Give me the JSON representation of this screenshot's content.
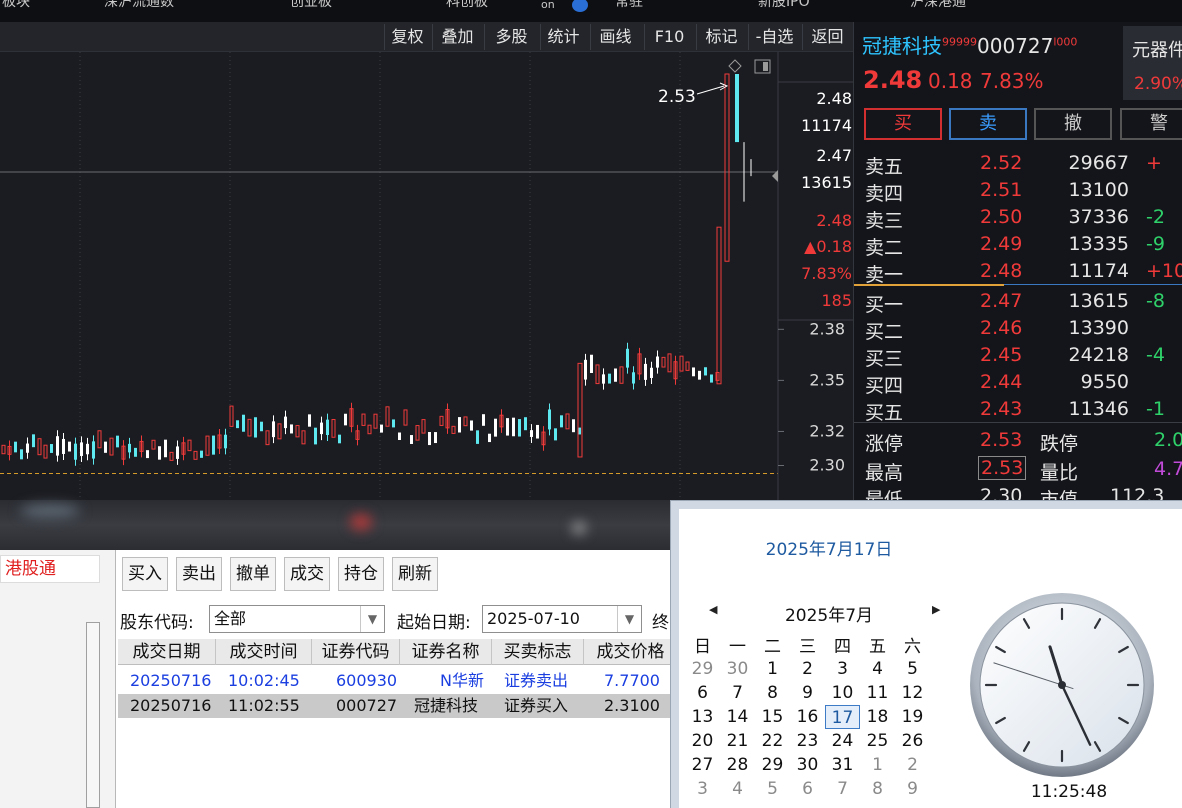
{
  "top_strip": {
    "items": [
      "板块",
      "深沪流通数",
      "创业板",
      "科创板",
      "on",
      "常驻",
      "新股IPO",
      "沪深港通"
    ]
  },
  "chart_toolbar": {
    "buttons": [
      "复权",
      "叠加",
      "多股",
      "统计",
      "画线",
      "F10",
      "标记",
      "-自选",
      "返回"
    ]
  },
  "chart": {
    "annotation_high": "2.53",
    "price_axis": {
      "ask_price": "2.48",
      "ask_vol": "11174",
      "bid_price": "2.47",
      "bid_vol": "13615",
      "last": "2.48",
      "change": "▲0.18",
      "pct": "7.83%",
      "vol": "185"
    },
    "y_ticks": [
      "2.38",
      "2.35",
      "2.32",
      "2.30"
    ]
  },
  "chart_data": {
    "type": "bar",
    "description_hint": "",
    "y_ticks": [
      2.38,
      2.35,
      2.32,
      2.3
    ],
    "ylim": [
      2.29,
      2.54
    ],
    "high": 2.53,
    "last": 2.48,
    "reference_price": 2.3
  },
  "stock": {
    "name": "冠捷科技",
    "name_sup": "99999",
    "code": "000727",
    "code_sup": "l000",
    "tag": "元器件",
    "tag_pct": "2.90%",
    "price": "2.48",
    "change": "0.18",
    "pct": "7.83%"
  },
  "actions": [
    "买",
    "卖",
    "撤",
    "警"
  ],
  "orderbook": {
    "sells": [
      {
        "label": "卖五",
        "price": "2.52",
        "vol": "29667",
        "delta": "+"
      },
      {
        "label": "卖四",
        "price": "2.51",
        "vol": "13100",
        "delta": ""
      },
      {
        "label": "卖三",
        "price": "2.50",
        "vol": "37336",
        "delta": "-2"
      },
      {
        "label": "卖二",
        "price": "2.49",
        "vol": "13335",
        "delta": "-9"
      },
      {
        "label": "卖一",
        "price": "2.48",
        "vol": "11174",
        "delta": "+10"
      }
    ],
    "buys": [
      {
        "label": "买一",
        "price": "2.47",
        "vol": "13615",
        "delta": "-8"
      },
      {
        "label": "买二",
        "price": "2.46",
        "vol": "13390",
        "delta": ""
      },
      {
        "label": "买三",
        "price": "2.45",
        "vol": "24218",
        "delta": "-4"
      },
      {
        "label": "买四",
        "price": "2.44",
        "vol": "9550",
        "delta": ""
      },
      {
        "label": "买五",
        "price": "2.43",
        "vol": "11346",
        "delta": "-1"
      }
    ]
  },
  "stats": {
    "limit_up_label": "涨停",
    "limit_up": "2.53",
    "limit_down_label": "跌停",
    "limit_down": "2.0",
    "high_label": "最高",
    "high": "2.53",
    "volume_ratio_label": "量比",
    "volume_ratio": "4.7",
    "low_label": "最低",
    "low": "2.30",
    "market_cap_label": "市值",
    "market_cap": "112.3"
  },
  "trade_panel": {
    "nav_hk": "港股通",
    "buttons": [
      "买入",
      "卖出",
      "撤单",
      "成交",
      "持仓",
      "刷新"
    ],
    "shareholder_label": "股东代码:",
    "shareholder_value": "全部",
    "start_label": "起始日期:",
    "start_value": "2025-07-10",
    "end_label": "终",
    "columns": [
      "成交日期",
      "成交时间",
      "证券代码",
      "证券名称",
      "买卖标志",
      "成交价格"
    ],
    "rows": [
      {
        "date": "20250716",
        "time": "10:02:45",
        "code": "600930",
        "name": "N华新",
        "side": "证券卖出",
        "price": "7.7700"
      },
      {
        "date": "20250716",
        "time": "11:02:55",
        "code": "000727",
        "name": "冠捷科技",
        "side": "证券买入",
        "price": "2.3100"
      }
    ]
  },
  "calendar": {
    "date_title": "2025年7月17日",
    "month_title": "2025年7月",
    "weekdays": [
      "日",
      "一",
      "二",
      "三",
      "四",
      "五",
      "六"
    ],
    "weeks": [
      [
        "29",
        "30",
        "1",
        "2",
        "3",
        "4",
        "5"
      ],
      [
        "6",
        "7",
        "8",
        "9",
        "10",
        "11",
        "12"
      ],
      [
        "13",
        "14",
        "15",
        "16",
        "17",
        "18",
        "19"
      ],
      [
        "20",
        "21",
        "22",
        "23",
        "24",
        "25",
        "26"
      ],
      [
        "27",
        "28",
        "29",
        "30",
        "31",
        "1",
        "2"
      ],
      [
        "3",
        "4",
        "5",
        "6",
        "7",
        "8",
        "9"
      ]
    ],
    "today": "17",
    "time": "11:25:48",
    "clock": {
      "hour": 11,
      "minute": 25,
      "second": 48
    }
  },
  "colors": {
    "up": "#f03a3a",
    "down": "#5ee8f0",
    "ask_bar": "#ffffff",
    "accent_blue": "#1e5aa0"
  }
}
